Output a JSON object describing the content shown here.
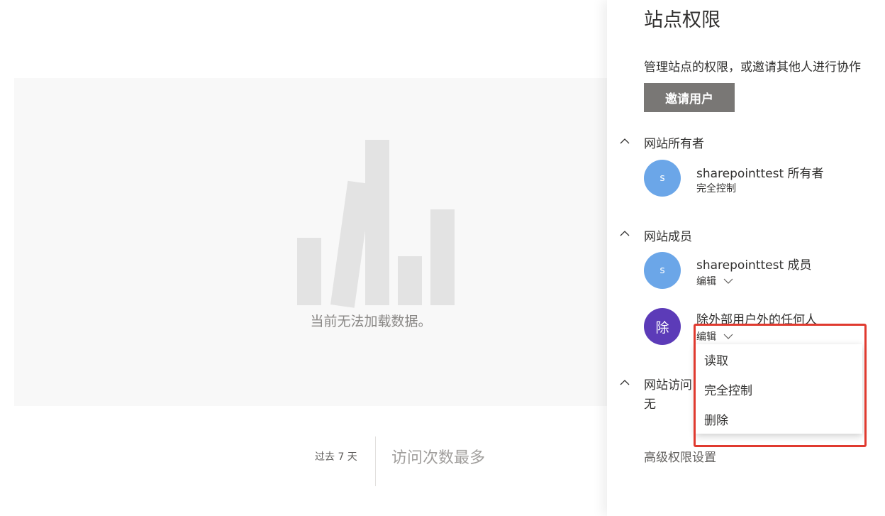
{
  "background": {
    "empty_message": "当前无法加载数据。",
    "period_label": "过去 7 天",
    "most_visited_label": "访问次数最多"
  },
  "panel": {
    "title": "站点权限",
    "description": "管理站点的权限，或邀请其他人进行协作",
    "invite_button": "邀请用户",
    "advanced_link": "高级权限设置",
    "groups": {
      "owners": {
        "title": "网站所有者",
        "members": [
          {
            "initial": "s",
            "name": "sharepointtest 所有者",
            "permission": "完全控制",
            "avatar_color": "#6ba6e8"
          }
        ]
      },
      "members": {
        "title": "网站成员",
        "members": [
          {
            "initial": "s",
            "name": "sharepointtest 成员",
            "permission": "编辑",
            "avatar_color": "#6ba6e8"
          },
          {
            "initial": "除",
            "name": "除外部用户外的任何人",
            "permission": "编辑",
            "avatar_color": "#5c3bb8"
          }
        ]
      },
      "visitors": {
        "title": "网站访问",
        "empty_text": "无"
      }
    }
  },
  "dropdown_menu": {
    "items": [
      "读取",
      "完全控制",
      "删除"
    ]
  },
  "colors": {
    "accent_button": "#797775",
    "highlight_border": "#e03a2f"
  }
}
